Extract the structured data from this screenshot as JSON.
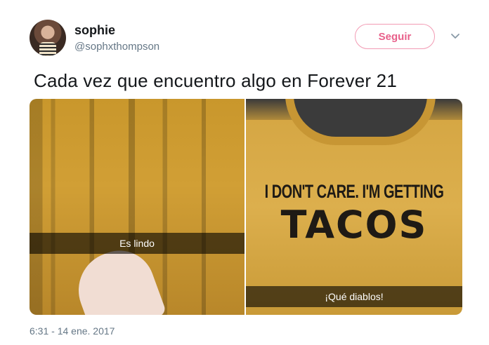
{
  "user": {
    "display_name": "sophie",
    "handle": "@sophxthompson"
  },
  "follow_button": {
    "label": "Seguir"
  },
  "tweet": {
    "text": "Cada vez que encuentro algo en Forever 21",
    "timestamp": "6:31 - 14 ene. 2017"
  },
  "photos": [
    {
      "caption": "Es lindo"
    },
    {
      "caption": "¡Qué diablos!",
      "shirt_text_line1": "I DON'T CARE. I'M GETTING",
      "shirt_text_line2": "TACOS"
    }
  ],
  "icons": {
    "avatar": "profile-photo",
    "menu": "chevron-down-icon"
  },
  "colors": {
    "follow_accent": "#e8608a",
    "secondary_text": "#657786",
    "primary_text": "#14171a"
  }
}
